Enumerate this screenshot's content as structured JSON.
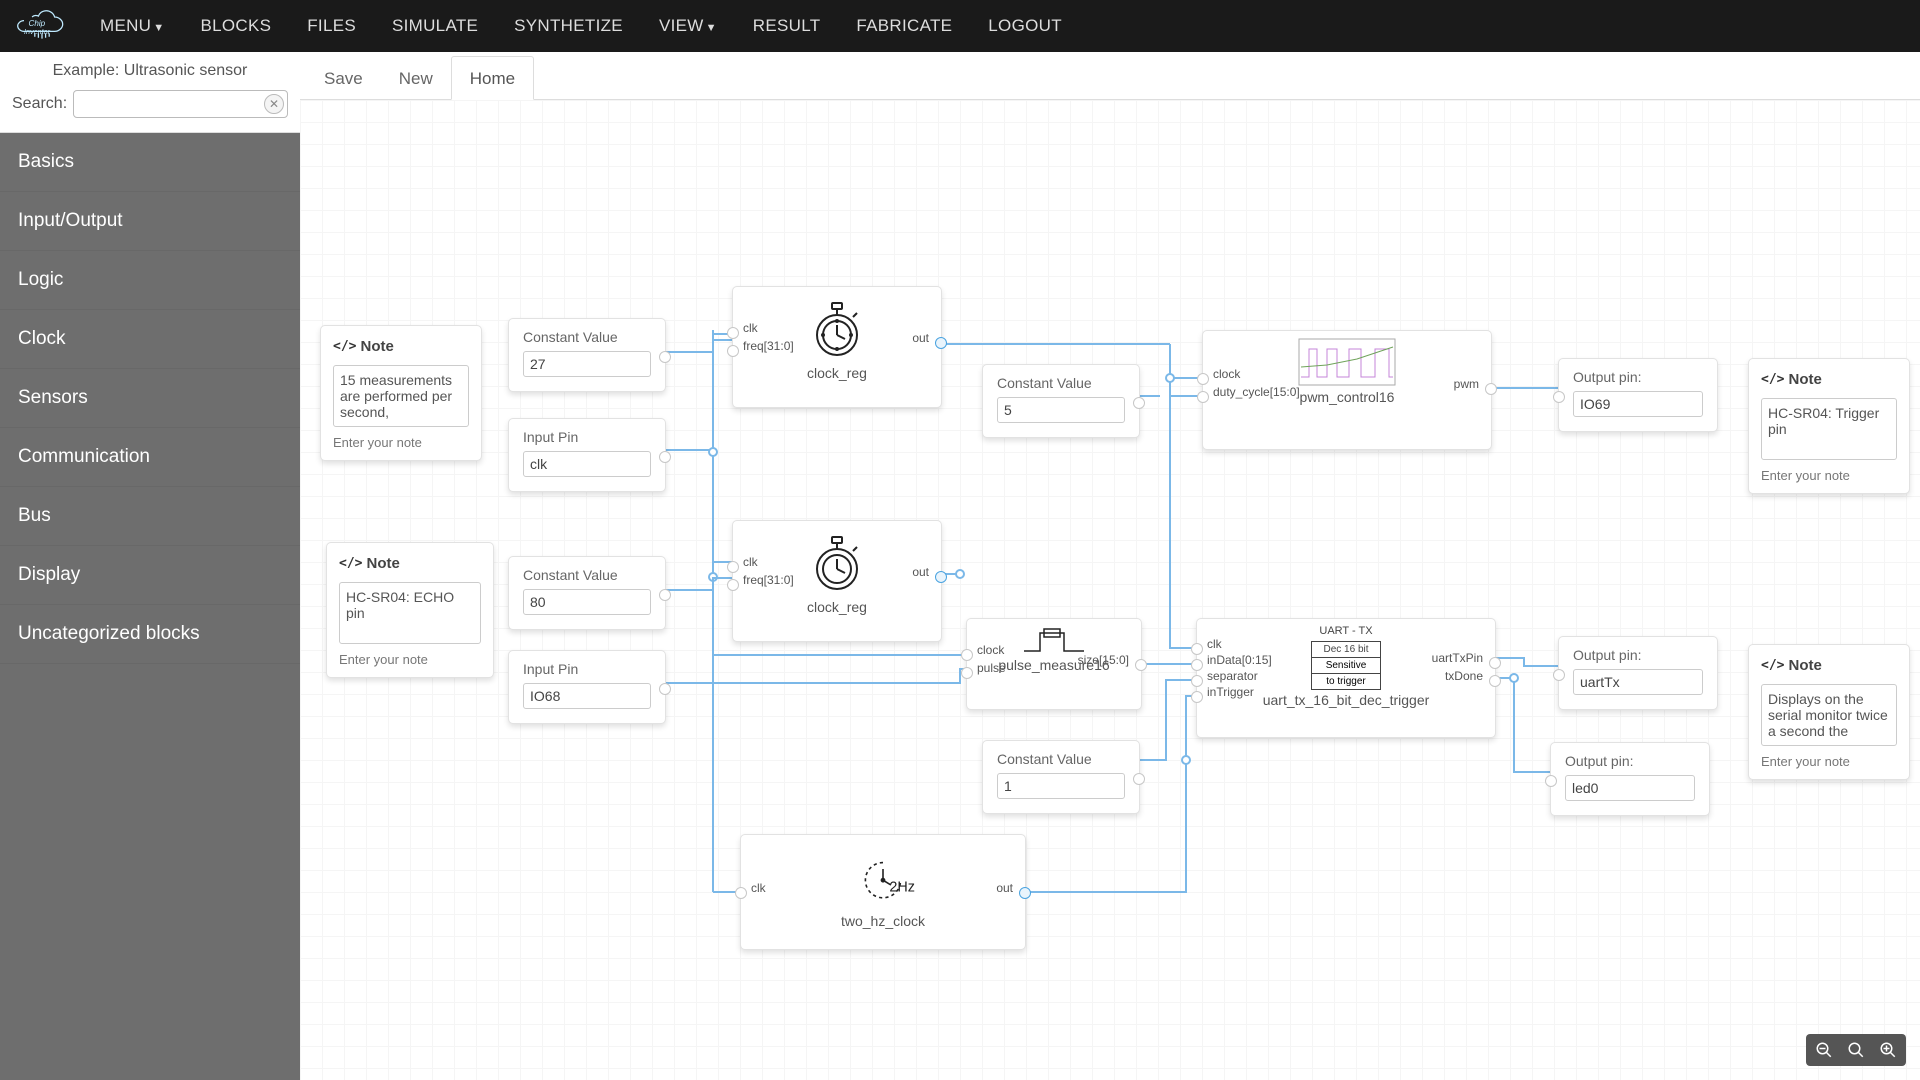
{
  "nav": {
    "items": [
      "MENU",
      "BLOCKS",
      "FILES",
      "SIMULATE",
      "SYNTHETIZE",
      "VIEW",
      "RESULT",
      "FABRICATE",
      "LOGOUT"
    ],
    "dropdowns": [
      true,
      false,
      false,
      false,
      false,
      true,
      false,
      false,
      false
    ]
  },
  "sidebar": {
    "title": "Example: Ultrasonic sensor",
    "search_label": "Search:",
    "search_value": "",
    "categories": [
      "Basics",
      "Input/Output",
      "Logic",
      "Clock",
      "Sensors",
      "Communication",
      "Bus",
      "Display",
      "Uncategorized blocks"
    ]
  },
  "tabs": {
    "items": [
      "Save",
      "New",
      "Home"
    ],
    "active": 2
  },
  "blocks": {
    "note1": {
      "title": "Note",
      "text": "15 measurements are performed per second,",
      "enter": "Enter your note"
    },
    "const27": {
      "cap": "Constant Value",
      "val": "27"
    },
    "in_clk": {
      "cap": "Input Pin",
      "val": "clk"
    },
    "note2": {
      "title": "Note",
      "text": "HC-SR04: ECHO pin",
      "enter": "Enter your note"
    },
    "const80": {
      "cap": "Constant Value",
      "val": "80"
    },
    "in_io68": {
      "cap": "Input Pin",
      "val": "IO68"
    },
    "clockreg1": {
      "name": "clock_reg",
      "ports": {
        "clk": "clk",
        "freq": "freq[31:0]",
        "out": "out"
      }
    },
    "clockreg2": {
      "name": "clock_reg",
      "ports": {
        "clk": "clk",
        "freq": "freq[31:0]",
        "out": "out"
      }
    },
    "const5": {
      "cap": "Constant Value",
      "val": "5"
    },
    "pwm": {
      "name": "pwm_control16",
      "ports": {
        "clock": "clock",
        "duty": "duty_cycle[15:0]",
        "pwm": "pwm"
      }
    },
    "out_io69": {
      "cap": "Output pin:",
      "val": "IO69"
    },
    "note3": {
      "title": "Note",
      "text": "HC-SR04: Trigger pin",
      "enter": "Enter your note"
    },
    "pulse": {
      "name": "pulse_measure16",
      "ports": {
        "clock": "clock",
        "pulse": "pulse",
        "size": "size[15:0]"
      }
    },
    "const1": {
      "cap": "Constant Value",
      "val": "1"
    },
    "uart": {
      "name": "uart_tx_16_bit_dec_trigger",
      "head": "UART - TX",
      "l1": "Dec 16 bit",
      "l2": "Sensitive",
      "l3": "to trigger",
      "ports": {
        "clk": "clk",
        "inData": "inData[0:15]",
        "sep": "separator",
        "trg": "inTrigger",
        "tx": "uartTxPin",
        "done": "txDone"
      }
    },
    "out_uart": {
      "cap": "Output pin:",
      "val": "uartTx"
    },
    "out_led": {
      "cap": "Output pin:",
      "val": "led0"
    },
    "note4": {
      "title": "Note",
      "text": "Displays on the serial monitor twice a second the",
      "enter": "Enter your note"
    },
    "twohz": {
      "name": "two_hz_clock",
      "label": "2Hz",
      "ports": {
        "clk": "clk",
        "out": "out"
      }
    }
  },
  "colors": {
    "wire": "#7bb8e8"
  }
}
